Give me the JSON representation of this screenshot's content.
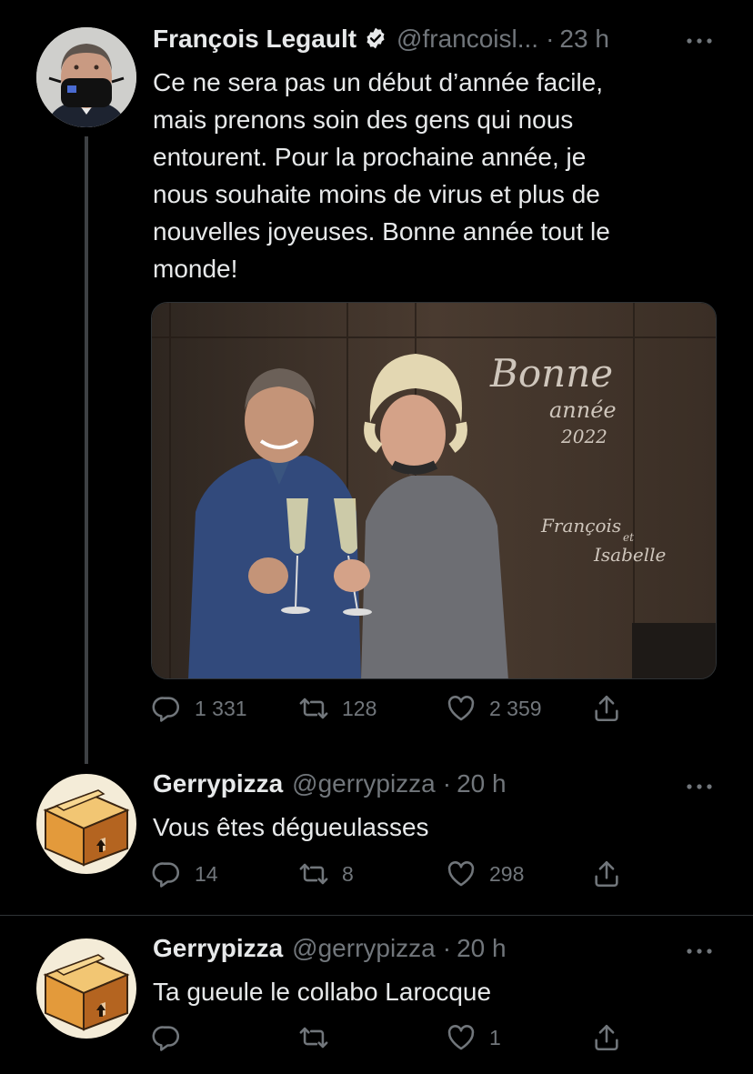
{
  "colors": {
    "background": "#000000",
    "text": "#e7e9ea",
    "muted": "#71767b",
    "divider": "#2f3336"
  },
  "tweets": [
    {
      "name": "François Legault",
      "verified": true,
      "handle": "@francoisl...",
      "dot": "·",
      "time": "23 h",
      "lines": [
        "Ce ne sera pas un début d’année facile,",
        "mais prenons soin des gens qui nous",
        "entourent. Pour la prochaine année, je",
        "nous souhaite moins de virus et plus de",
        "nouvelles joyeuses. Bonne année tout le",
        "monde!"
      ],
      "media": {
        "greeting_line1": "Bonne",
        "greeting_line2": "année",
        "year": "2022",
        "signature_name1": "François",
        "signature_and": "et",
        "signature_name2": "Isabelle"
      },
      "replies": "1 331",
      "retweets": "128",
      "likes": "2 359"
    },
    {
      "name": "Gerrypizza",
      "handle": "@gerrypizza",
      "dot": "·",
      "time": "20 h",
      "lines": [
        "Vous êtes dégueulasses"
      ],
      "replies": "14",
      "retweets": "8",
      "likes": "298"
    },
    {
      "name": "Gerrypizza",
      "handle": "@gerrypizza",
      "dot": "·",
      "time": "20 h",
      "lines": [
        "Ta gueule le collabo Larocque"
      ],
      "replies": "",
      "retweets": "",
      "likes": "1"
    }
  ],
  "icons": {
    "reply": "reply-icon",
    "retweet": "retweet-icon",
    "like": "heart-icon",
    "share": "share-icon",
    "more": "more-icon",
    "verified": "verified-badge-icon"
  }
}
